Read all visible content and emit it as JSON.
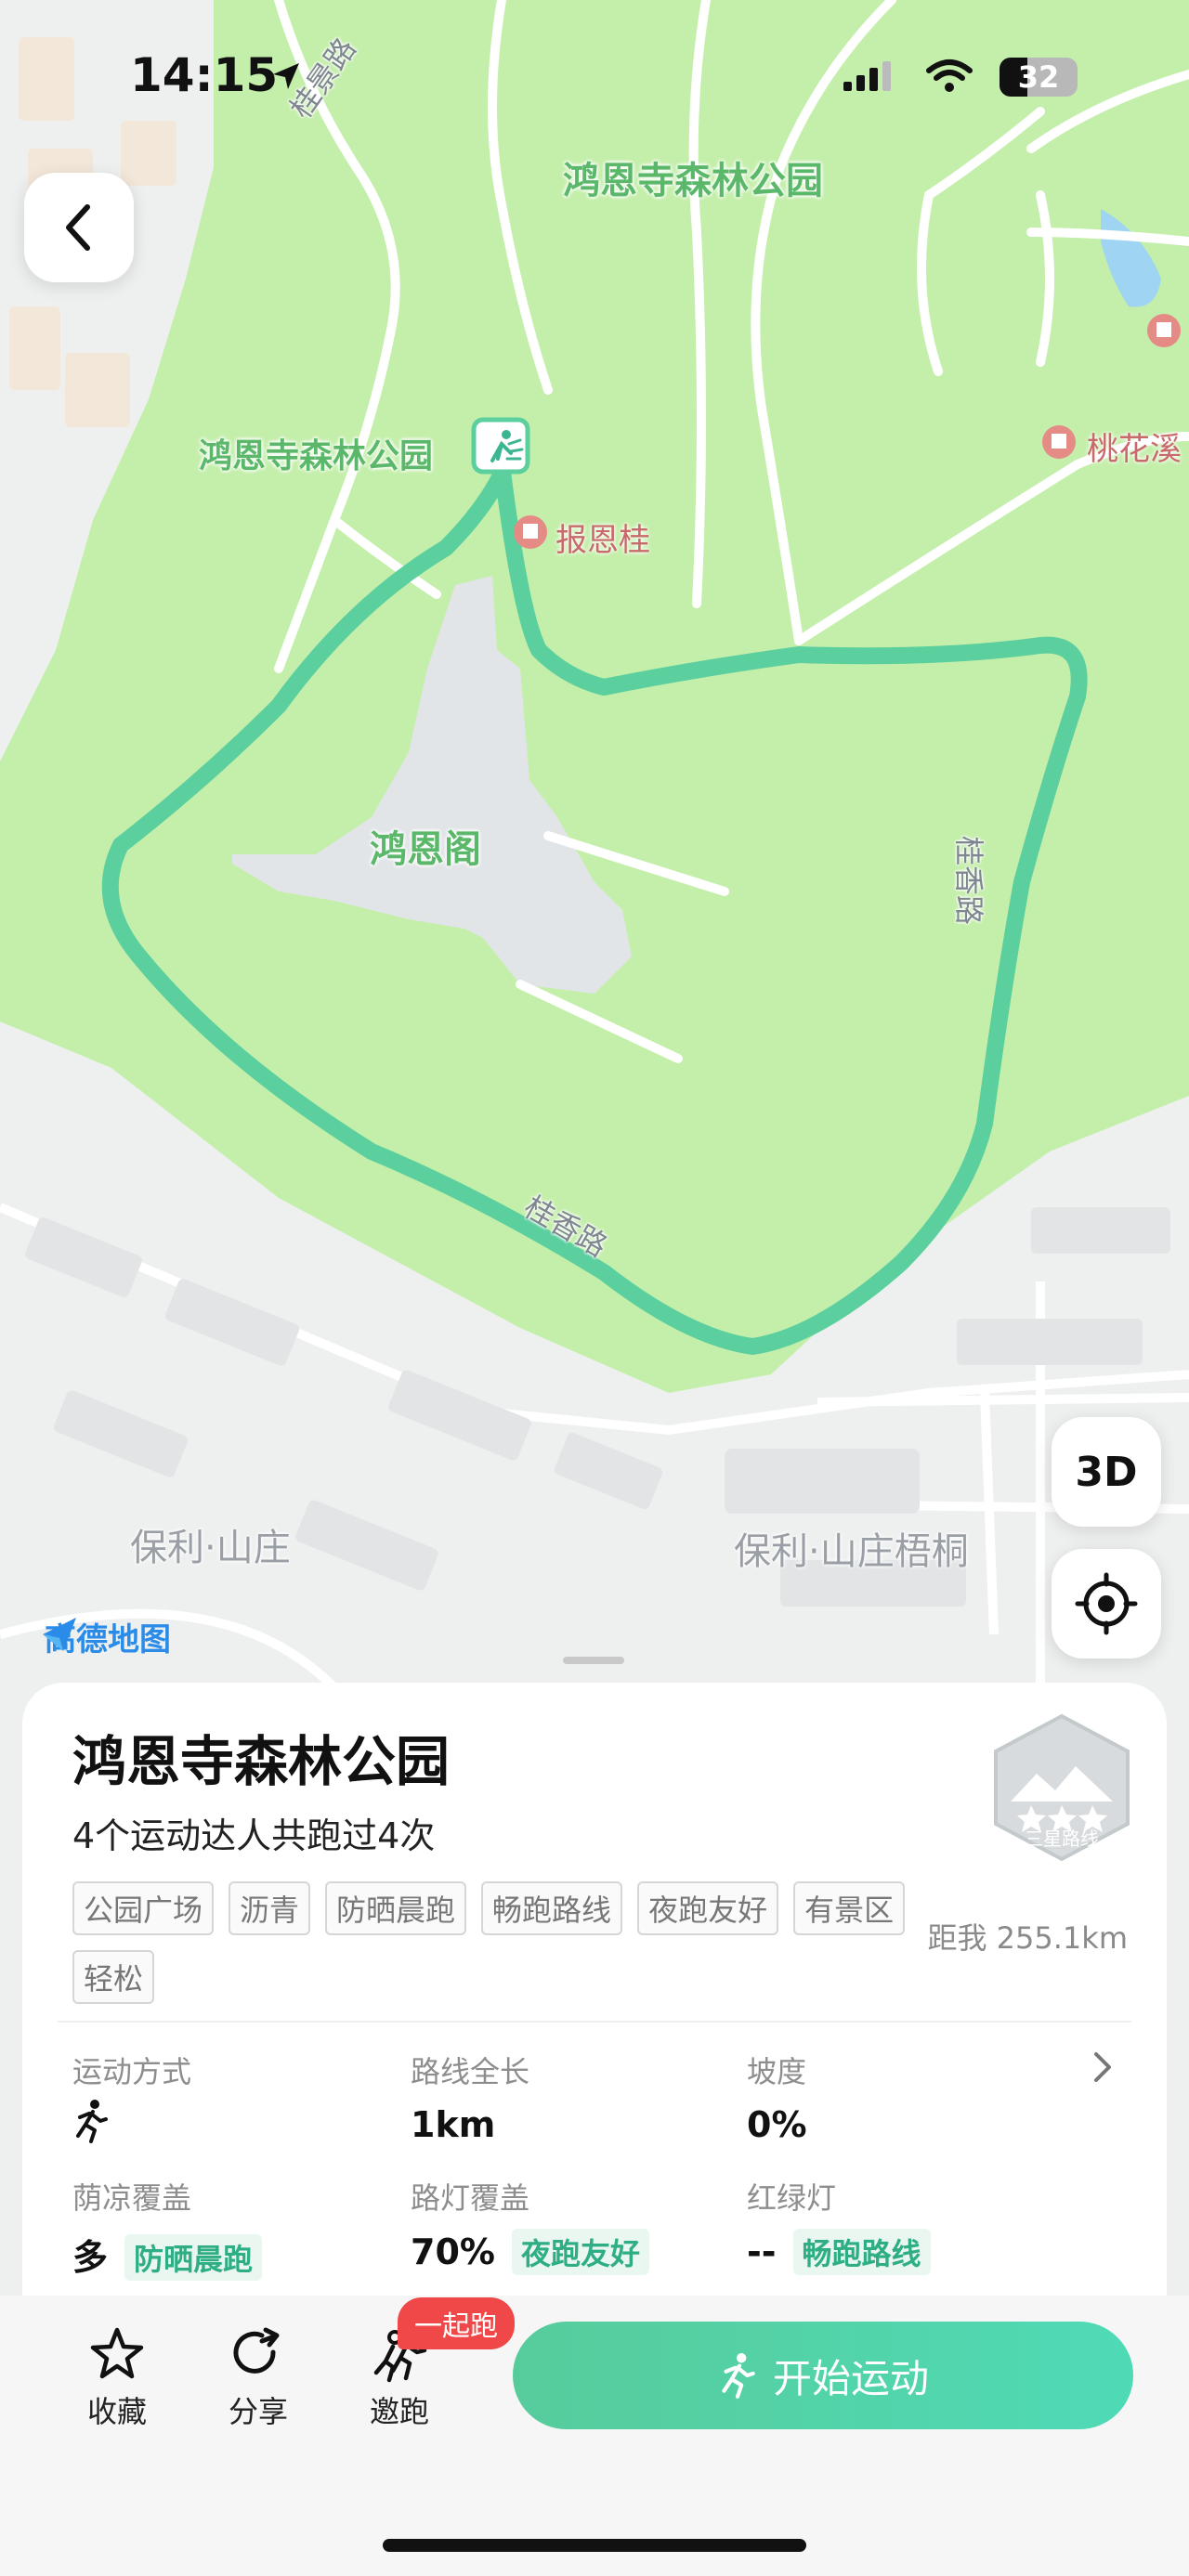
{
  "status": {
    "time": "14:15",
    "battery": "32"
  },
  "map": {
    "park_name_top": "鸿恩寺森林公园",
    "park_name_marker": "鸿恩寺森林公园",
    "poi_baoen": "报恩桂",
    "poi_taohua": "桃花溪",
    "pavilion": "鸿恩阁",
    "road_top": "桂景路",
    "road_right": "桂香路",
    "road_bottom": "桂香路",
    "area_left": "保利·山庄",
    "area_right": "保利·山庄梧桐",
    "brand": "高德地图",
    "btn_3d": "3D"
  },
  "sheet": {
    "title": "鸿恩寺森林公园",
    "subtitle": "4个运动达人共跑过4次",
    "badge_label": "三星路线",
    "tags": [
      "公园广场",
      "沥青",
      "防晒晨跑",
      "畅跑路线",
      "夜跑友好",
      "有景区",
      "轻松"
    ],
    "distance": "距我 255.1km",
    "stats": {
      "mode_label": "运动方式",
      "length_label": "路线全长",
      "length_value": "1km",
      "slope_label": "坡度",
      "slope_value": "0%",
      "shade_label": "荫凉覆盖",
      "shade_value": "多",
      "shade_chip": "防晒晨跑",
      "light_label": "路灯覆盖",
      "light_value": "70%",
      "light_chip": "夜跑友好",
      "traffic_label": "红绿灯",
      "traffic_value": "--",
      "traffic_chip": "畅跑路线"
    }
  },
  "bottom": {
    "fav": "收藏",
    "share": "分享",
    "invite": "邀跑",
    "invite_badge": "一起跑",
    "start": "开始运动"
  },
  "colors": {
    "route": "#5ccf9f",
    "park": "#c4efaa",
    "accent": "#2fae85",
    "badge": "#f04848"
  }
}
